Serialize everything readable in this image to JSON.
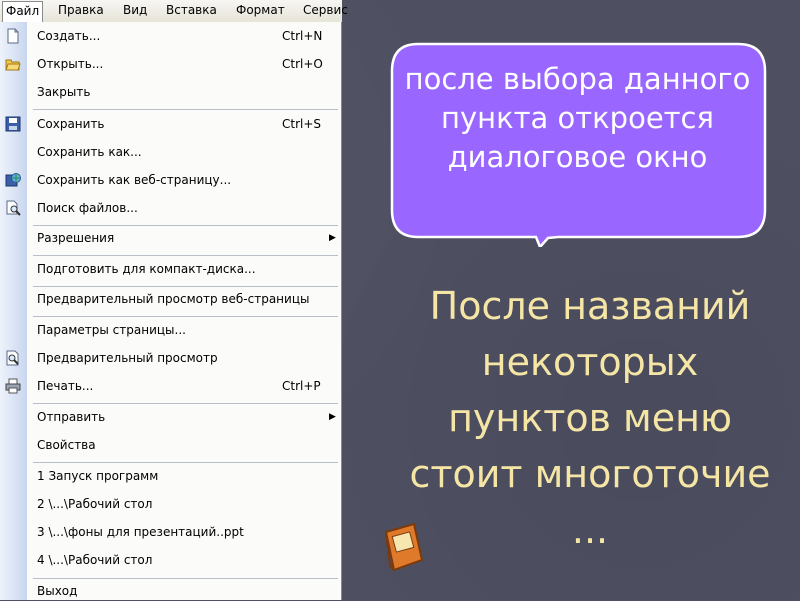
{
  "menubar": {
    "items": [
      "Файл",
      "Правка",
      "Вид",
      "Вставка",
      "Формат",
      "Сервис"
    ]
  },
  "file_menu": {
    "items": [
      {
        "label": "Создать...",
        "shortcut": "Ctrl+N",
        "icon": "new-document-icon"
      },
      {
        "label": "Открыть...",
        "shortcut": "Ctrl+O",
        "icon": "open-folder-icon"
      },
      {
        "label": "Закрыть",
        "shortcut": "",
        "icon": ""
      },
      {
        "label": "Сохранить",
        "shortcut": "Ctrl+S",
        "icon": "save-disk-icon"
      },
      {
        "label": "Сохранить как...",
        "shortcut": "",
        "icon": ""
      },
      {
        "label": "Сохранить как веб-страницу...",
        "shortcut": "",
        "icon": "save-web-icon"
      },
      {
        "label": "Поиск файлов...",
        "shortcut": "",
        "icon": "file-search-icon"
      },
      {
        "label": "Разрешения",
        "shortcut": "",
        "icon": "",
        "submenu": true
      },
      {
        "label": "Подготовить для компакт-диска...",
        "shortcut": "",
        "icon": ""
      },
      {
        "label": "Предварительный просмотр веб-страницы",
        "shortcut": "",
        "icon": ""
      },
      {
        "label": "Параметры страницы...",
        "shortcut": "",
        "icon": ""
      },
      {
        "label": "Предварительный просмотр",
        "shortcut": "",
        "icon": "print-preview-icon"
      },
      {
        "label": "Печать...",
        "shortcut": "Ctrl+P",
        "icon": "printer-icon"
      },
      {
        "label": "Отправить",
        "shortcut": "",
        "icon": "",
        "submenu": true
      },
      {
        "label": "Свойства",
        "shortcut": "",
        "icon": ""
      },
      {
        "label": "1 Запуск программ",
        "shortcut": "",
        "icon": ""
      },
      {
        "label": "2 \\...\\Рабочий стол",
        "shortcut": "",
        "icon": ""
      },
      {
        "label": "3 \\...\\фоны для презентаций..ppt",
        "shortcut": "",
        "icon": ""
      },
      {
        "label": "4 \\...\\Рабочий стол",
        "shortcut": "",
        "icon": ""
      },
      {
        "label": "Выход",
        "shortcut": "",
        "icon": ""
      }
    ]
  },
  "callout": {
    "text": "после выбора данного пункта откроется диалоговое окно",
    "fill": "#9966ff"
  },
  "main_text": "После названий некоторых пунктов меню стоит многоточие ...",
  "book_icon": "guest-book-icon",
  "colors": {
    "background": "#4e5062",
    "main_text": "#f5e6a6",
    "callout_fill": "#9966ff"
  }
}
